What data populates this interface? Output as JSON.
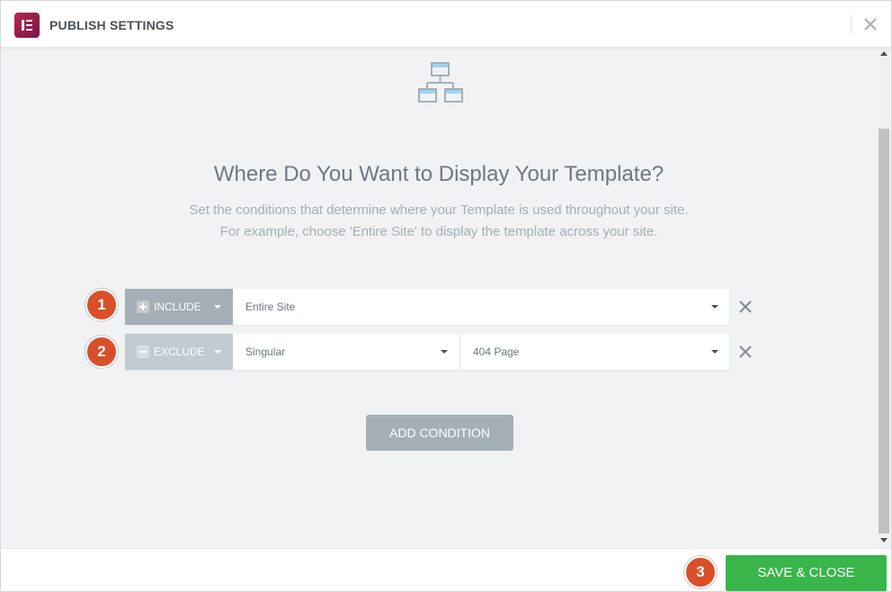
{
  "header": {
    "title": "PUBLISH SETTINGS",
    "logo_icon": "elementor-logo-icon",
    "close_icon": "close-icon"
  },
  "main": {
    "title": "Where Do You Want to Display Your Template?",
    "description_line1": "Set the conditions that determine where your Template is used throughout your site.",
    "description_line2": "For example, choose 'Entire Site' to display the template across your site.",
    "conditions": [
      {
        "badge": "1",
        "type": "INCLUDE",
        "fields": [
          "Entire Site"
        ]
      },
      {
        "badge": "2",
        "type": "EXCLUDE",
        "fields": [
          "Singular",
          "404 Page"
        ]
      }
    ],
    "add_condition_label": "ADD CONDITION"
  },
  "footer": {
    "badge": "3",
    "save_label": "SAVE & CLOSE"
  },
  "colors": {
    "brand": "#93003f",
    "badge": "#d94f2a",
    "save": "#39b54a",
    "muted": "#a4afb7"
  }
}
